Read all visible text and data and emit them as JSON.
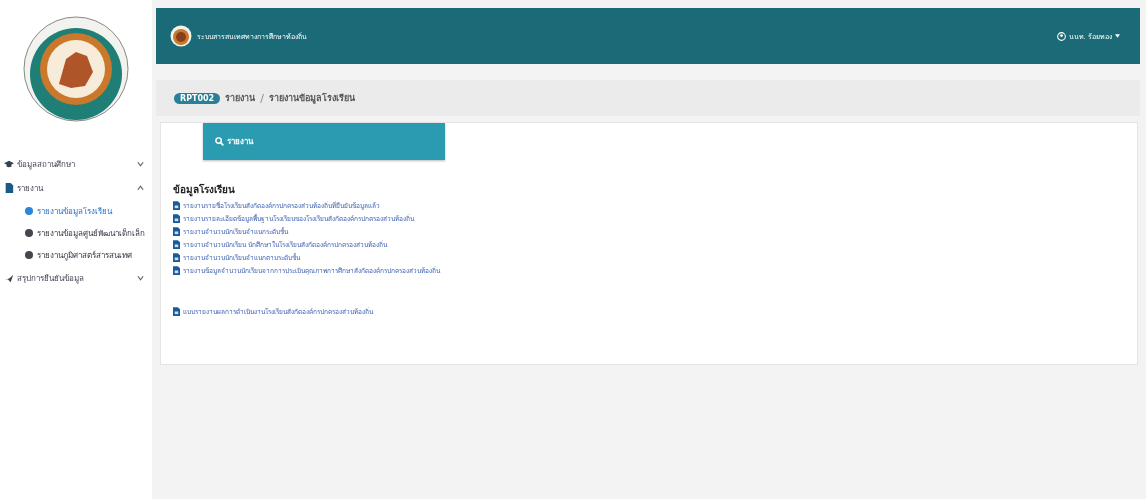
{
  "sidebar": {
    "items": [
      {
        "label": "ข้อมูลสถานศึกษา",
        "expanded": false
      },
      {
        "label": "รายงาน",
        "expanded": true,
        "children": [
          {
            "label": "รายงานข้อมูลโรงเรียน",
            "selected": true
          },
          {
            "label": "รายงานข้อมูลศูนย์พัฒนาเด็กเล็ก",
            "selected": false
          },
          {
            "label": "รายงานภูมิศาสตร์สารสนเทศ",
            "selected": false
          }
        ]
      },
      {
        "label": "สรุปการยืนยันข้อมูล",
        "expanded": false
      }
    ]
  },
  "header": {
    "title": "ระบบสารสนเทศทางการศึกษาท้องถิ่น",
    "user": "นนท. ร้อยทอง"
  },
  "breadcrumb": {
    "badge": "RPT002",
    "separator": "/",
    "items": [
      "รายงาน",
      "รายงานข้อมูลโรงเรียน"
    ]
  },
  "report_card": {
    "title": "รายงาน"
  },
  "section": {
    "title": "ข้อมูลโรงเรียน",
    "links": [
      "รายงานรายชื่อโรงเรียนสังกัดองค์กรปกครองส่วนท้องถิ่นที่ยืนยันข้อมูลแล้ว",
      "รายงานรายละเอียดข้อมูลพื้นฐานโรงเรียนของโรงเรียนสังกัดองค์กรปกครองส่วนท้องถิ่น",
      "รายงานจำนวนนักเรียนจำแนกระดับชั้น",
      "รายงานจำนวนนักเรียน นักศึกษาในโรงเรียนสังกัดองค์กรปกครองส่วนท้องถิ่น",
      "รายงานจำนวนนักเรียนจำแนกตามระดับชั้น",
      "รายงานข้อมูลจำนวนนักเรียนจากการประเมินคุณภาพการศึกษาสังกัดองค์กรปกครองส่วนท้องถิ่น"
    ],
    "extra_links": [
      "แบบรายงานผลการดำเนินงานโรงเรียนสังกัดองค์กรปกครองส่วนท้องถิ่น"
    ]
  }
}
